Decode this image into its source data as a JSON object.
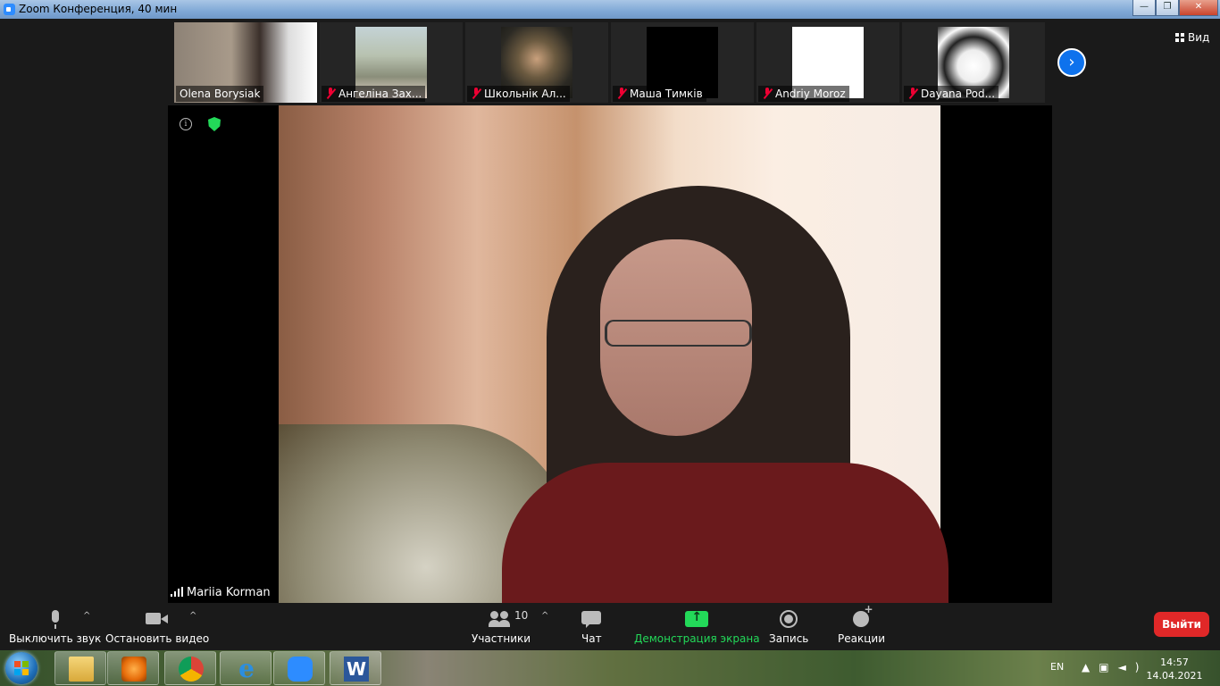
{
  "window": {
    "title": "Zoom Конференция, 40 мин",
    "controls": {
      "minimize": "—",
      "restore": "❐",
      "close": "✕"
    }
  },
  "participants": [
    {
      "name": "Olena Borysiak",
      "muted": false,
      "bg": "#5b5148"
    },
    {
      "name": "Ангеліна Зах...",
      "muted": true,
      "bg": "#9aa58a"
    },
    {
      "name": "Школьнік Ал...",
      "muted": true,
      "bg": "#3d3227"
    },
    {
      "name": "Маша Тимків",
      "muted": true,
      "bg": "#000000"
    },
    {
      "name": "Andriy Moroz",
      "muted": true,
      "bg": "#ffffff"
    },
    {
      "name": "Dayana Pod...",
      "muted": true,
      "bg": "#d8d8d8"
    }
  ],
  "view_button": {
    "label": "Вид"
  },
  "active_speaker": {
    "name": "Mariia Korman"
  },
  "toolbar": {
    "mute_label": "Выключить звук",
    "video_label": "Остановить видео",
    "participants_label": "Участники",
    "participants_count": "10",
    "chat_label": "Чат",
    "share_label": "Демонстрация экрана",
    "record_label": "Запись",
    "reactions_label": "Реакции",
    "leave_label": "Выйти"
  },
  "taskbar": {
    "language": "EN",
    "time": "14:57",
    "date": "14.04.2021",
    "apps": [
      "file-explorer",
      "media-player",
      "chrome",
      "internet-explorer",
      "zoom",
      "word"
    ]
  },
  "colors": {
    "accent_blue": "#0e72ed",
    "share_green": "#23d959",
    "leave_red": "#e02828",
    "muted_red": "#ee0033"
  }
}
